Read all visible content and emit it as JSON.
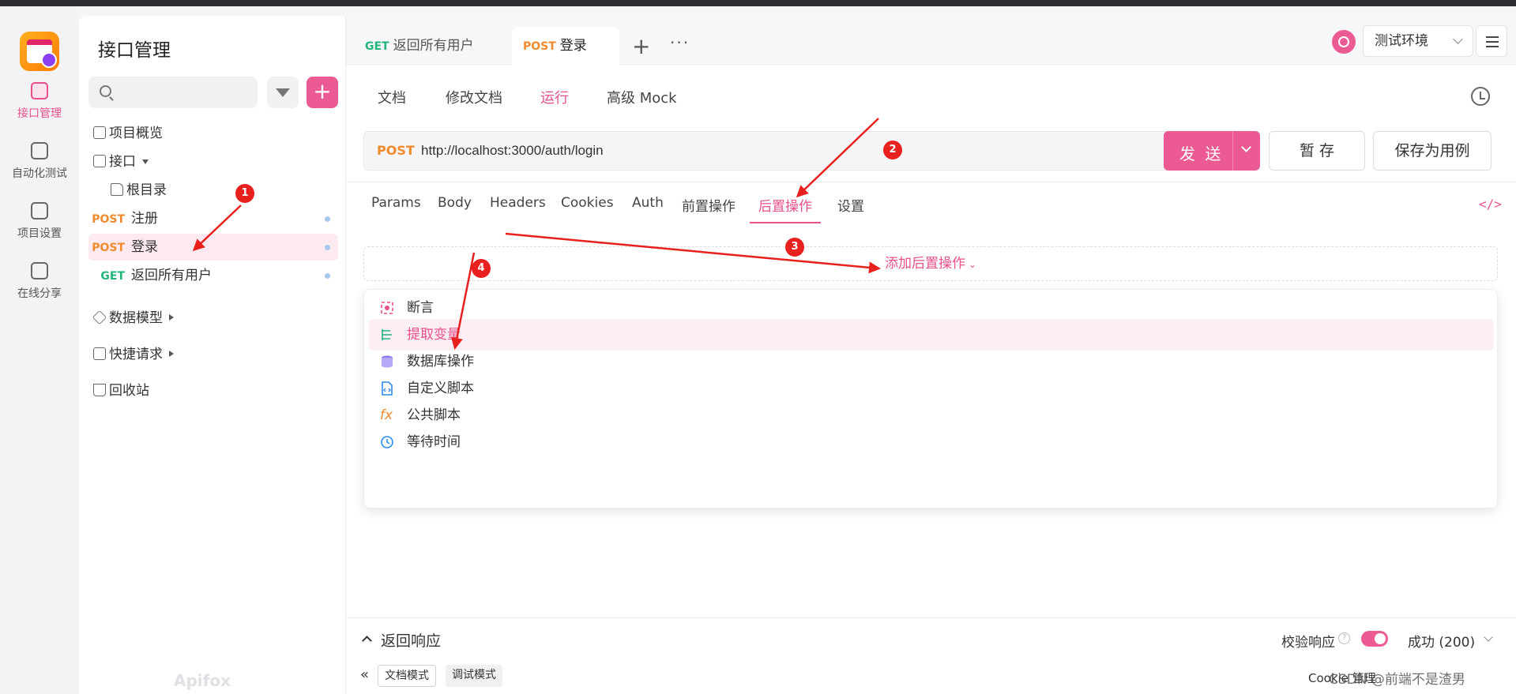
{
  "rail": {
    "items": [
      {
        "label": "接口管理",
        "icon": "api-icon"
      },
      {
        "label": "自动化测试",
        "icon": "stack-icon"
      },
      {
        "label": "项目设置",
        "icon": "settings-icon"
      },
      {
        "label": "在线分享",
        "icon": "share-icon"
      }
    ]
  },
  "sidebar": {
    "title": "接口管理",
    "search_placeholder": "",
    "tree": {
      "overview": "项目概览",
      "api": "接口",
      "root": "根目录",
      "items": [
        {
          "method": "POST",
          "name": "注册"
        },
        {
          "method": "POST",
          "name": "登录"
        },
        {
          "method": "GET",
          "name": "返回所有用户"
        }
      ],
      "models": "数据模型",
      "quick": "快捷请求",
      "trash": "回收站"
    },
    "watermark": "Apifox"
  },
  "tabs": [
    {
      "method": "GET",
      "label": "返回所有用户"
    },
    {
      "method": "POST",
      "label": "登录"
    }
  ],
  "header": {
    "env": "测试环境"
  },
  "subtabs": [
    "文档",
    "修改文档",
    "运行",
    "高级 Mock"
  ],
  "request": {
    "method": "POST",
    "url": "http://localhost:3000/auth/login",
    "send": "发 送",
    "save": "暂 存",
    "save_case": "保存为用例"
  },
  "reqtabs": [
    "Params",
    "Body",
    "Headers",
    "Cookies",
    "Auth",
    "前置操作",
    "后置操作",
    "设置"
  ],
  "add_post": "添加后置操作",
  "dropdown": [
    {
      "label": "断言",
      "icon": "assert-icon"
    },
    {
      "label": "提取变量",
      "icon": "extract-icon"
    },
    {
      "label": "数据库操作",
      "icon": "database-icon"
    },
    {
      "label": "自定义脚本",
      "icon": "script-icon"
    },
    {
      "label": "公共脚本",
      "icon": "fx-icon"
    },
    {
      "label": "等待时间",
      "icon": "clock-icon"
    }
  ],
  "response": {
    "title": "返回响应",
    "verify": "校验响应",
    "status": "成功 (200)"
  },
  "bottom": {
    "doc_mode": "文档模式",
    "debug_mode": "调试模式",
    "cookie": "Cookie 管理",
    "watermark": "CSDN @前端不是渣男"
  },
  "annotations": [
    "1",
    "2",
    "3",
    "4"
  ],
  "colors": {
    "accent": "#ec5a93",
    "post": "#f08a2c",
    "get": "#22b57a",
    "annotation": "#e8201e"
  }
}
